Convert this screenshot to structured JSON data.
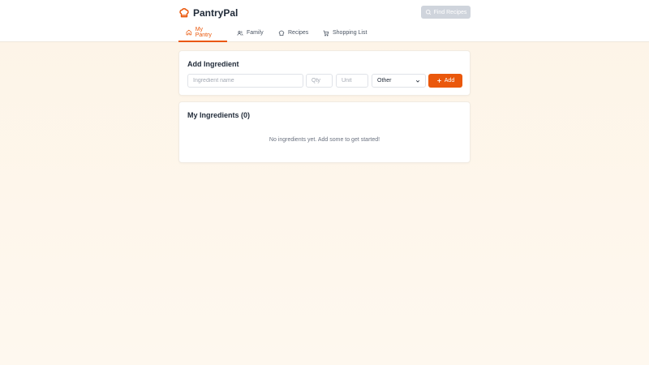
{
  "app": {
    "name": "PantryPal",
    "logo_icon": "chef-hat-icon"
  },
  "header": {
    "find_recipes_label": "Find Recipes"
  },
  "nav": {
    "tabs": [
      {
        "label": "My Pantry",
        "icon": "home-icon",
        "active": true
      },
      {
        "label": "Family",
        "icon": "users-icon",
        "active": false
      },
      {
        "label": "Recipes",
        "icon": "chef-hat-icon",
        "active": false
      },
      {
        "label": "Shopping List",
        "icon": "cart-icon",
        "active": false
      }
    ]
  },
  "add_ingredient": {
    "title": "Add Ingredient",
    "name_placeholder": "Ingredient name",
    "qty_placeholder": "Qty",
    "unit_placeholder": "Unit",
    "category_selected": "Other",
    "add_label": "Add"
  },
  "ingredients": {
    "title": "My Ingredients (0)",
    "empty_message": "No ingredients yet. Add some to get started!"
  },
  "colors": {
    "accent": "#ea580c",
    "disabled_button": "#cfd4dc"
  }
}
